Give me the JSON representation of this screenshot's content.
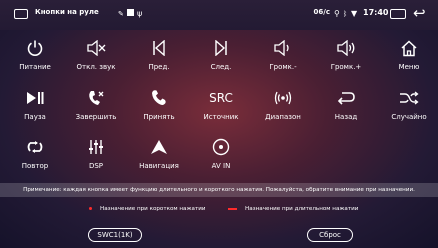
{
  "status_bar": {
    "title": "Кнопки на руле",
    "indicators": "06/c",
    "time": "17:40"
  },
  "buttons": [
    {
      "label": "Питание",
      "icon": "power-icon"
    },
    {
      "label": "Откл. звук",
      "icon": "mute-icon"
    },
    {
      "label": "Пред.",
      "icon": "previous-icon"
    },
    {
      "label": "След.",
      "icon": "next-icon"
    },
    {
      "label": "Громк.-",
      "icon": "volume-down-icon"
    },
    {
      "label": "Громк.+",
      "icon": "volume-up-icon"
    },
    {
      "label": "Меню",
      "icon": "home-icon"
    },
    {
      "label": "Пауза",
      "icon": "play-pause-icon"
    },
    {
      "label": "Завершить",
      "icon": "hang-up-icon"
    },
    {
      "label": "Принять",
      "icon": "phone-icon"
    },
    {
      "label": "Источник",
      "icon": "source-icon",
      "text": "SRC"
    },
    {
      "label": "Диапазон",
      "icon": "radio-band-icon"
    },
    {
      "label": "Назад",
      "icon": "return-icon"
    },
    {
      "label": "Случайно",
      "icon": "shuffle-icon"
    },
    {
      "label": "Повтор",
      "icon": "repeat-icon"
    },
    {
      "label": "DSP",
      "icon": "equalizer-icon"
    },
    {
      "label": "Навигация",
      "icon": "navigation-icon"
    },
    {
      "label": "AV IN",
      "icon": "av-in-icon"
    }
  ],
  "note": "Примечание: каждая кнопка имеет функцию длительного и короткого нажатия. Пожалуйста, обратите внимание при назначении.",
  "legend": {
    "short_press": "Назначение при коротком нажатии",
    "long_press": "Назначение при длительном нажатии",
    "short_color": "#ff2b2b",
    "long_color": "#ff2b2b"
  },
  "actions": {
    "swc_label": "SWC1(1K)",
    "reset_label": "Сброс"
  }
}
